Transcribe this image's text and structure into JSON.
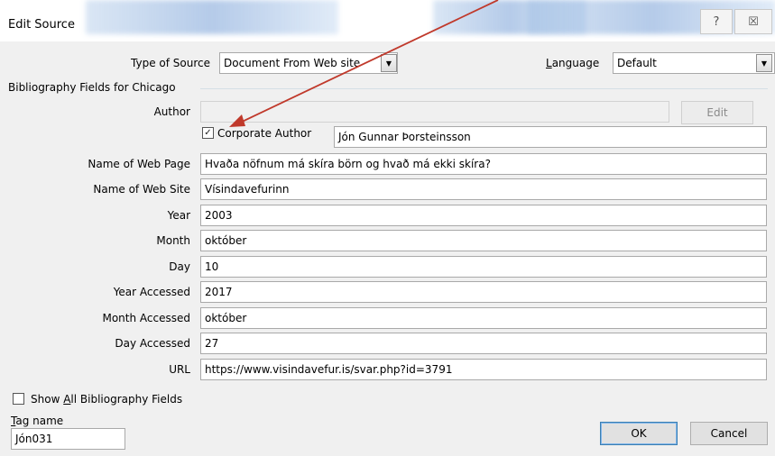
{
  "window": {
    "title": "Edit Source",
    "help_glyph": "?",
    "close_glyph": "☒"
  },
  "source_type": {
    "label": "Type of Source",
    "value": "Document From Web site",
    "language_label_ul": "L",
    "language_label_rest": "anguage",
    "language_value": "Default"
  },
  "group": {
    "title": "Bibliography Fields for Chicago"
  },
  "author": {
    "label": "Author",
    "value": "",
    "edit_button": "Edit",
    "corporate_checked": "✓",
    "corporate_label": "Corporate Author",
    "corporate_value": "Jón Gunnar Þorsteinsson"
  },
  "fields": [
    {
      "label": "Name of Web Page",
      "value": "Hvaða nöfnum má skíra börn og hvað má ekki skíra?"
    },
    {
      "label": "Name of Web Site",
      "value": "Vísindavefurinn"
    },
    {
      "label": "Year",
      "value": "2003"
    },
    {
      "label": "Month",
      "value": "október"
    },
    {
      "label": "Day",
      "value": "10"
    },
    {
      "label": "Year Accessed",
      "value": "2017"
    },
    {
      "label": "Month Accessed",
      "value": "október"
    },
    {
      "label": "Day Accessed",
      "value": "27"
    },
    {
      "label": "URL",
      "value": "https://www.visindavefur.is/svar.php?id=3791"
    }
  ],
  "footer": {
    "show_all_pre": "Show ",
    "show_all_ul": "A",
    "show_all_post": "ll Bibliography Fields",
    "tag_label_ul": "T",
    "tag_label_rest": "ag name",
    "tag_value": "Jón031",
    "ok": "OK",
    "cancel": "Cancel"
  },
  "colors": {
    "dialog_bg": "#f0f0f0",
    "arrow": "#c0392b",
    "default_button_border": "#3c7fb1"
  }
}
